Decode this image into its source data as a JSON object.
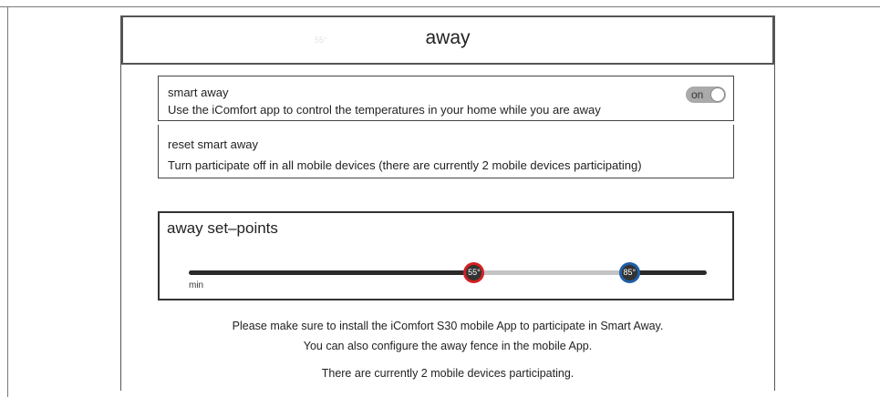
{
  "header": {
    "title": "away",
    "ghost_temp": "55°"
  },
  "smart_away": {
    "title": "smart away",
    "description": "Use the iComfort app to control the temperatures in your home while you are away",
    "toggle_label": "on",
    "toggle_state": true
  },
  "reset_smart_away": {
    "title": "reset smart away",
    "description": "Turn participate off in all mobile devices (there are currently 2 mobile devices participating)"
  },
  "setpoints": {
    "title": "away set–points",
    "min_label": "min",
    "range": {
      "min": 0,
      "max": 100
    },
    "low": {
      "value": 55,
      "label": "55°",
      "color": "#d32020"
    },
    "high": {
      "value": 85,
      "label": "85°",
      "color": "#1f5fa8"
    },
    "colors": {
      "track_dark": "#2a2a2a",
      "track_light": "#c4c4c4"
    }
  },
  "info": {
    "line1": "Please make sure to install the iComfort S30 mobile App to participate in Smart Away.",
    "line2": "You can also configure the away fence in the mobile App.",
    "line3": "There are currently 2 mobile devices participating."
  }
}
